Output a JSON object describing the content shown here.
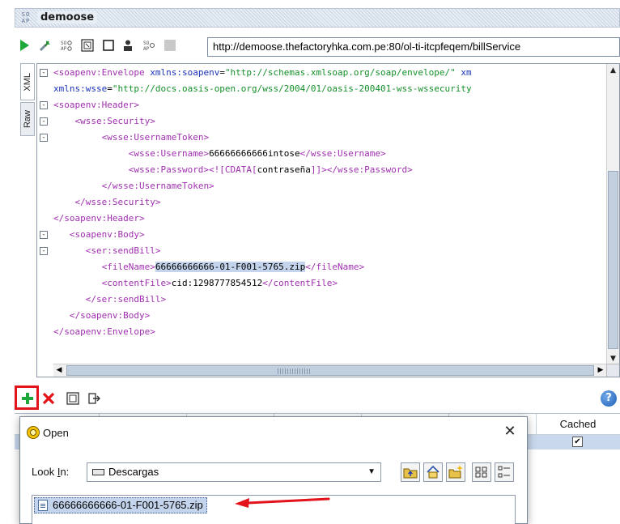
{
  "window": {
    "badge": "SO\nAP",
    "title": "demoose"
  },
  "toolbar": {
    "endpoint_url": "http://demoose.thefactoryhka.com.pe:80/ol-ti-itcpfeqem/billService",
    "icons": [
      "run-icon",
      "wrench-icon",
      "soap-settings-icon",
      "format-icon",
      "stop-icon",
      "auth-icon",
      "wsa-icon",
      "disabled-icon"
    ],
    "accent_green": "#1fa83a"
  },
  "side_tabs": {
    "xml": "XML",
    "raw": "Raw"
  },
  "editor": {
    "lines": [
      {
        "fold": "-",
        "parts": [
          [
            "t",
            "<soapenv:Envelope "
          ],
          [
            "a",
            "xmlns:soapenv"
          ],
          [
            "x",
            "="
          ],
          [
            "v",
            "\"http://schemas.xmlsoap.org/soap/envelope/\""
          ],
          [
            "x",
            " "
          ],
          [
            "a",
            "xm"
          ]
        ]
      },
      {
        "fold": "",
        "parts": [
          [
            "a",
            "xmlns:wsse"
          ],
          [
            "x",
            "="
          ],
          [
            "v",
            "\"http://docs.oasis-open.org/wss/2004/01/oasis-200401-wss-wssecurity"
          ]
        ]
      },
      {
        "fold": "-",
        "parts": [
          [
            "t",
            "<soapenv:Header>"
          ]
        ]
      },
      {
        "fold": "-",
        "parts": [
          [
            "x",
            "    "
          ],
          [
            "t",
            "<wsse:Security>"
          ]
        ]
      },
      {
        "fold": "-",
        "parts": [
          [
            "x",
            "         "
          ],
          [
            "t",
            "<wsse:UsernameToken>"
          ]
        ]
      },
      {
        "fold": "",
        "parts": [
          [
            "x",
            "              "
          ],
          [
            "t",
            "<wsse:Username>"
          ],
          [
            "x",
            "66666666666intose"
          ],
          [
            "t",
            "</wsse:Username>"
          ]
        ]
      },
      {
        "fold": "",
        "parts": [
          [
            "x",
            "              "
          ],
          [
            "t",
            "<wsse:Password>"
          ],
          [
            "t",
            "<![CDATA["
          ],
          [
            "x",
            "contraseña"
          ],
          [
            "t",
            "]]>"
          ],
          [
            "t",
            "</wsse:Password>"
          ]
        ]
      },
      {
        "fold": "",
        "parts": [
          [
            "x",
            "         "
          ],
          [
            "t",
            "</wsse:UsernameToken>"
          ]
        ]
      },
      {
        "fold": "",
        "parts": [
          [
            "x",
            "    "
          ],
          [
            "t",
            "</wsse:Security>"
          ]
        ]
      },
      {
        "fold": "",
        "parts": [
          [
            "t",
            "</soapenv:Header>"
          ]
        ]
      },
      {
        "fold": "-",
        "parts": [
          [
            "x",
            "   "
          ],
          [
            "t",
            "<soapenv:Body>"
          ]
        ]
      },
      {
        "fold": "-",
        "parts": [
          [
            "x",
            "      "
          ],
          [
            "t",
            "<ser:sendBill>"
          ]
        ]
      },
      {
        "fold": "",
        "parts": [
          [
            "x",
            "         "
          ],
          [
            "t",
            "<fileName>"
          ],
          [
            "hl",
            "66666666666-01-F001-5765.zip"
          ],
          [
            "t",
            "</fileName>"
          ]
        ]
      },
      {
        "fold": "",
        "parts": [
          [
            "x",
            "         "
          ],
          [
            "t",
            "<contentFile>"
          ],
          [
            "x",
            "cid:1298777854512"
          ],
          [
            "t",
            "</contentFile>"
          ]
        ]
      },
      {
        "fold": "",
        "parts": [
          [
            "x",
            "      "
          ],
          [
            "t",
            "</ser:sendBill>"
          ]
        ]
      },
      {
        "fold": "",
        "parts": [
          [
            "x",
            "   "
          ],
          [
            "t",
            "</soapenv:Body>"
          ]
        ]
      },
      {
        "fold": "",
        "parts": [
          [
            "t",
            "</soapenv:Envelope>"
          ]
        ]
      }
    ]
  },
  "attachments": {
    "icons": [
      "add-attachment-icon",
      "remove-attachment-icon",
      "attachment-props-icon",
      "export-attachment-icon"
    ],
    "cached_header": "Cached",
    "cached_checked": true,
    "cached_mark": "✔"
  },
  "open_dialog": {
    "title": "Open",
    "close_glyph": "✕",
    "look_in_label": "Look In:",
    "look_in_value": "Descargas",
    "selected_file": "66666666666-01-F001-5765.zip"
  },
  "colors": {
    "tag": "#a030b0",
    "attr": "#1a32b8",
    "value": "#15902a",
    "highlight": "#c3d4ec",
    "callout_red": "#e2131a"
  }
}
